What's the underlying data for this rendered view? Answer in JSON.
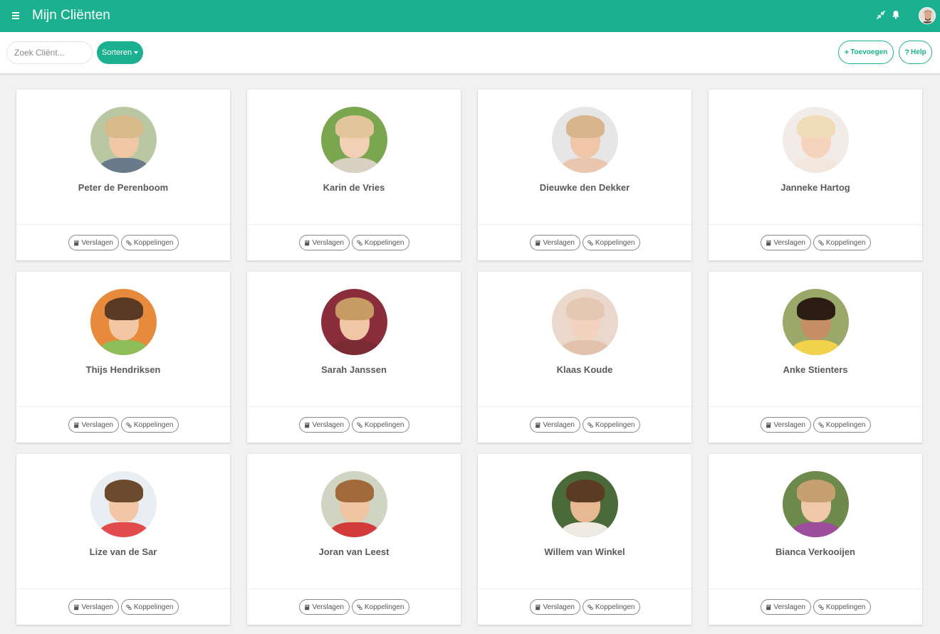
{
  "app": {
    "title": "Mijn Cliënten"
  },
  "icons": {
    "menu": "menu-icon",
    "compress": "compress-icon",
    "bell": "bell-icon",
    "user": "user-avatar"
  },
  "toolbar": {
    "search_placeholder": "Zoek Cliënt...",
    "sort_label": "Sorteren",
    "add_label": "Toevoegen",
    "help_label": "Help"
  },
  "colors": {
    "accent": "#1bb08f",
    "background": "#f1f1f1",
    "card": "#ffffff",
    "text": "#5a5a5a"
  },
  "card_actions": {
    "reports": "Verslagen",
    "links": "Koppelingen"
  },
  "clients": [
    {
      "name": "Peter de Perenboom",
      "photo": {
        "bg": "#b9c8a2",
        "skin": "#f0c7a4",
        "hair": "#d8b98a",
        "shirt": "#6a7a8a"
      }
    },
    {
      "name": "Karin de Vries",
      "photo": {
        "bg": "#7aa64f",
        "skin": "#f2cfb5",
        "hair": "#e2c59a",
        "shirt": "#d9d2c3"
      }
    },
    {
      "name": "Dieuwke den Dekker",
      "photo": {
        "bg": "#e6e6e6",
        "skin": "#f1c6a8",
        "hair": "#d9b58e",
        "shirt": "#e9c6ad"
      }
    },
    {
      "name": "Janneke Hartog",
      "photo": {
        "bg": "#f1ece8",
        "skin": "#f6d3bd",
        "hair": "#f0dcb8",
        "shirt": "#f3e6dc"
      }
    },
    {
      "name": "Thijs Hendriksen",
      "photo": {
        "bg": "#e88a3c",
        "skin": "#f2c6a2",
        "hair": "#5a3a24",
        "shirt": "#8fbd5a"
      }
    },
    {
      "name": "Sarah Janssen",
      "photo": {
        "bg": "#8a2e3c",
        "skin": "#f0c7a6",
        "hair": "#c89a64",
        "shirt": "#7a2b34"
      }
    },
    {
      "name": "Klaas Koude",
      "photo": {
        "bg": "#ead8cc",
        "skin": "#f4d2c0",
        "hair": "#e5c8b4",
        "shirt": "#e2c2ad"
      }
    },
    {
      "name": "Anke Stienters",
      "photo": {
        "bg": "#9aa86a",
        "skin": "#c58e64",
        "hair": "#2c1d14",
        "shirt": "#f2d24a"
      }
    },
    {
      "name": "Lize van de Sar",
      "photo": {
        "bg": "#e9eef2",
        "skin": "#f2c7a8",
        "hair": "#6b4a2e",
        "shirt": "#e24b4b"
      }
    },
    {
      "name": "Joran van Leest",
      "photo": {
        "bg": "#cfd4c3",
        "skin": "#f0c5a2",
        "hair": "#a06a3a",
        "shirt": "#d33a3a"
      }
    },
    {
      "name": "Willem van Winkel",
      "photo": {
        "bg": "#4b6a3a",
        "skin": "#e7b892",
        "hair": "#5b3b22",
        "shirt": "#efeae2"
      }
    },
    {
      "name": "Bianca Verkooijen",
      "photo": {
        "bg": "#6d8a4c",
        "skin": "#f0c8aa",
        "hair": "#c6a071",
        "shirt": "#9d4d9c"
      }
    }
  ]
}
